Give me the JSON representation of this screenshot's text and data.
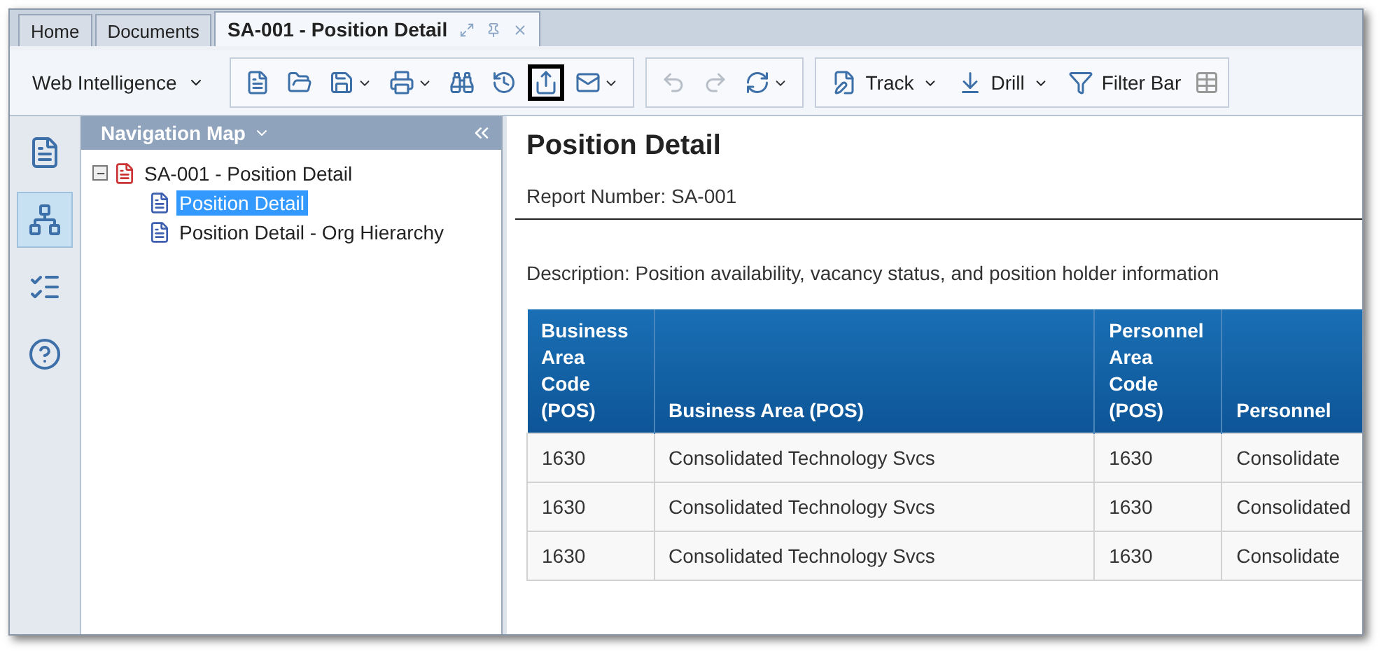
{
  "tabs": [
    {
      "label": "Home",
      "selected": false
    },
    {
      "label": "Documents",
      "selected": false
    },
    {
      "label": "SA-001 - Position Detail",
      "selected": true
    }
  ],
  "toolbar": {
    "app_menu": "Web Intelligence",
    "icon_buttons": [
      {
        "disabled": false,
        "dropdown": false,
        "highlighted": false
      },
      {
        "disabled": false,
        "dropdown": false,
        "highlighted": false
      },
      {
        "disabled": false,
        "dropdown": true,
        "highlighted": false
      },
      {
        "disabled": false,
        "dropdown": true,
        "highlighted": false
      },
      {
        "disabled": false,
        "dropdown": false,
        "highlighted": false
      },
      {
        "disabled": false,
        "dropdown": false,
        "highlighted": false
      },
      {
        "disabled": false,
        "dropdown": false,
        "highlighted": true
      },
      {
        "disabled": false,
        "dropdown": true,
        "highlighted": false
      },
      {
        "disabled": true,
        "dropdown": false,
        "highlighted": false
      },
      {
        "disabled": true,
        "dropdown": false,
        "highlighted": false
      },
      {
        "disabled": false,
        "dropdown": true,
        "highlighted": false
      }
    ],
    "buttons": [
      {
        "label": "Track",
        "dropdown": true
      },
      {
        "label": "Drill",
        "dropdown": true
      },
      {
        "label": "Filter Bar",
        "dropdown": false
      }
    ]
  },
  "side_tools": [
    {
      "selected": false
    },
    {
      "selected": true
    },
    {
      "selected": false
    },
    {
      "selected": false
    }
  ],
  "navigation": {
    "title": "Navigation Map",
    "tree": [
      {
        "label": "SA-001 - Position Detail",
        "expanded": true,
        "selected": false,
        "children": [
          {
            "label": "Position Detail",
            "selected": true
          },
          {
            "label": "Position Detail - Org Hierarchy",
            "selected": false
          }
        ]
      }
    ]
  },
  "report": {
    "title": "Position Detail",
    "report_number": "Report Number: SA-001",
    "description": "Description: Position availability, vacancy status, and position holder information",
    "table": {
      "columns": [
        "Business Area Code (POS)",
        "Business Area (POS)",
        "Personnel Area Code (POS)",
        "Personnel"
      ],
      "rows": [
        [
          "1630",
          "Consolidated Technology Svcs",
          "1630",
          "Consolidate"
        ],
        [
          "1630",
          "Consolidated Technology Svcs",
          "1630",
          "Consolidated"
        ],
        [
          "1630",
          "Consolidated Technology Svcs",
          "1630",
          "Consolidate"
        ]
      ]
    }
  }
}
